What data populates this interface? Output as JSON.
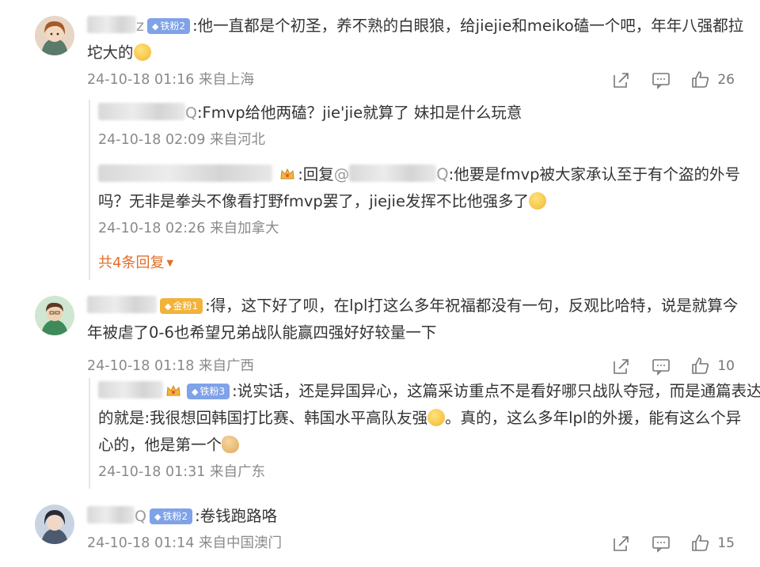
{
  "comments": [
    {
      "user_tail": "z",
      "badge": "铁粉2",
      "text": ":他一直都是个初圣，养不熟的白眼狼，给jiejie和meiko磕一个吧，年年八强都拉",
      "text2": "坨大的",
      "meta": "24-10-18 01:16 来自上海",
      "likes": "26",
      "replies": [
        {
          "user_tail": "Q",
          "text": ":Fmvp给他两磕？jie'jie就算了 妹扣是什么玩意",
          "meta": "24-10-18 02:09 来自河北"
        },
        {
          "prefix": ":回复",
          "at": "@",
          "at_tail": "Q",
          "text": ":他要是fmvp被大家承认至于有个盗的外号",
          "text2": "吗？无非是拳头不像看打野fmvp罢了，jiejie发挥不比他强多了",
          "meta": "24-10-18 02:26 来自加拿大"
        }
      ],
      "more_replies": "共4条回复"
    },
    {
      "badge": "金粉1",
      "text": ":得，这下好了呗，在lpl打这么多年祝福都没有一句，反观比哈特，说是就算今",
      "text2": "年被虐了0-6也希望兄弟战队能赢四强好好较量一下",
      "meta": "24-10-18 01:18 来自广西",
      "likes": "10",
      "replies": [
        {
          "badge": "铁粉3",
          "text": ":说实话，还是异国异心，这篇采访重点不是看好哪只战队夺冠，而是通篇表达",
          "text2": "的就是:我很想回韩国打比赛、韩国水平高队友强",
          "text3": "。真的，这么多年lpl的外援，能有这么个异",
          "text4": "心的，他是第一个",
          "meta": "24-10-18 01:31 来自广东"
        }
      ]
    },
    {
      "user_tail": "Q",
      "badge": "铁粉2",
      "text": ":卷钱跑路咯",
      "meta": "24-10-18 01:14 来自中国澳门",
      "likes": "15"
    }
  ],
  "colors": {
    "accent_more": "#e06e2a",
    "badge_iron": "#7fa2e8",
    "badge_gold": "#f2b33a",
    "meta": "#8a8a8a"
  },
  "icons": [
    "share-icon",
    "comment-icon",
    "like-icon"
  ]
}
